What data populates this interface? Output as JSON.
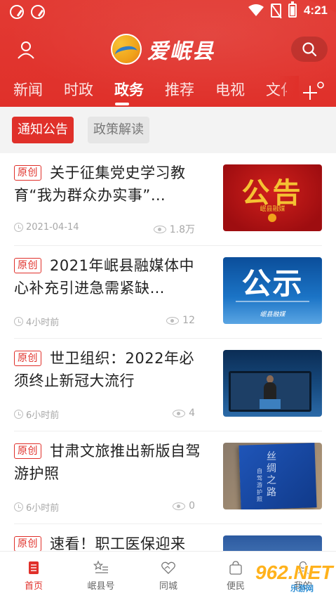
{
  "status_bar": {
    "time": "4:21"
  },
  "header": {
    "app_name": "爱岷县",
    "brand_color": "#e0302a"
  },
  "tabs": [
    {
      "label": "新闻"
    },
    {
      "label": "时政"
    },
    {
      "label": "政务",
      "active": true
    },
    {
      "label": "推荐"
    },
    {
      "label": "电视"
    },
    {
      "label": "文化"
    }
  ],
  "sub_tabs": [
    {
      "label": "通知公告",
      "active": true
    },
    {
      "label": "政策解读"
    }
  ],
  "articles": [
    {
      "badge": "原创",
      "title": "关于征集党史学习教育“我为群众办实事”…",
      "time": "2021-04-14",
      "views": "1.8万",
      "thumb_title": "公告",
      "thumb_caption": "岷县融媒"
    },
    {
      "badge": "原创",
      "title": "2021年岷县融媒体中心补充引进急需紧缺…",
      "time": "4小时前",
      "views": "12",
      "thumb_title": "公示",
      "thumb_caption": "岷县融媒"
    },
    {
      "badge": "原创",
      "title": "世卫组织：2022年必须终止新冠大流行",
      "time": "6小时前",
      "views": "4"
    },
    {
      "badge": "原创",
      "title": "甘肃文旅推出新版自驾游护照",
      "time": "6小时前",
      "views": "0",
      "thumb_title": "丝绸之路",
      "thumb_caption": "自驾游护照"
    },
    {
      "badge": "原创",
      "title": "速看！职工医保迎来"
    }
  ],
  "bottom_nav": [
    {
      "label": "首页",
      "icon": "home-icon",
      "active": true
    },
    {
      "label": "岷县号",
      "icon": "star-list-icon"
    },
    {
      "label": "同城",
      "icon": "heart-hands-icon"
    },
    {
      "label": "便民",
      "icon": "bag-icon"
    },
    {
      "label": "我的",
      "icon": "user-icon"
    }
  ],
  "watermark": {
    "text": "962.NET",
    "sub": "乐游网"
  }
}
